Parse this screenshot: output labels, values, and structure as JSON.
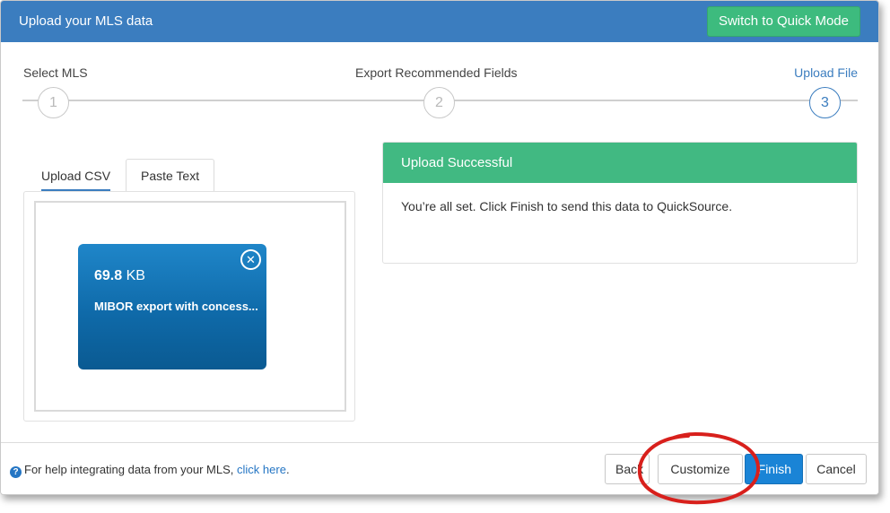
{
  "header": {
    "title": "Upload your MLS data",
    "quick_mode_label": "Switch to Quick Mode"
  },
  "steps": [
    {
      "label": "Select MLS",
      "number": "1",
      "active": false
    },
    {
      "label": "Export Recommended Fields",
      "number": "2",
      "active": false
    },
    {
      "label": "Upload File",
      "number": "3",
      "active": true
    }
  ],
  "tabs": [
    {
      "label": "Upload CSV",
      "active": true
    },
    {
      "label": "Paste Text",
      "active": false
    }
  ],
  "file": {
    "size_value": "69.8",
    "size_unit": "KB",
    "name": "MIBOR export with concess...",
    "remove_icon": "close-circle-icon"
  },
  "alert": {
    "title": "Upload Successful",
    "message": "You’re all set. Click Finish to send this data to QuickSource."
  },
  "footer": {
    "help_text": "For help integrating data from your MLS, ",
    "help_link": "click here",
    "help_suffix": ".",
    "help_icon": "question-circle-icon",
    "back_label": "Back",
    "customize_label": "Customize",
    "finish_label": "Finish",
    "cancel_label": "Cancel"
  },
  "colors": {
    "header": "#3b7dbf",
    "quick_mode": "#3dbb7e",
    "success": "#41b982",
    "primary": "#1a84d6",
    "file_card": "#0f6aa9",
    "annotation": "#d8201c"
  }
}
